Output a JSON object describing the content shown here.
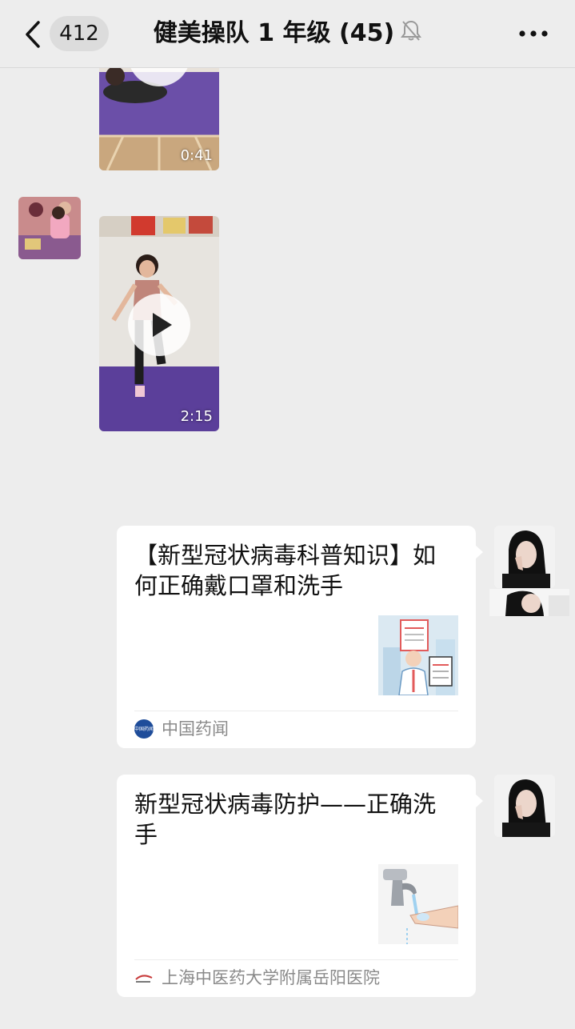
{
  "header": {
    "unread_count": "412",
    "title": "健美操队 1 年级 (45)"
  },
  "videos": [
    {
      "duration": "0:41"
    },
    {
      "duration": "2:15"
    }
  ],
  "articles": [
    {
      "title": "【新型冠状病毒科普知识】如何正确戴口罩和洗手",
      "source": "中国药闻",
      "source_icon_text": "中国药闻"
    },
    {
      "title": "新型冠状病毒防护——正确洗手",
      "source": "上海中医药大学附属岳阳医院"
    }
  ],
  "colors": {
    "background": "#ededed",
    "card": "#ffffff",
    "source_text": "#8a8a8a",
    "video_floor": "#5b3f9a"
  },
  "icons": {
    "back": "chevron-left-icon",
    "mute": "bell-off-icon",
    "more": "ellipsis-icon",
    "play": "play-icon"
  }
}
